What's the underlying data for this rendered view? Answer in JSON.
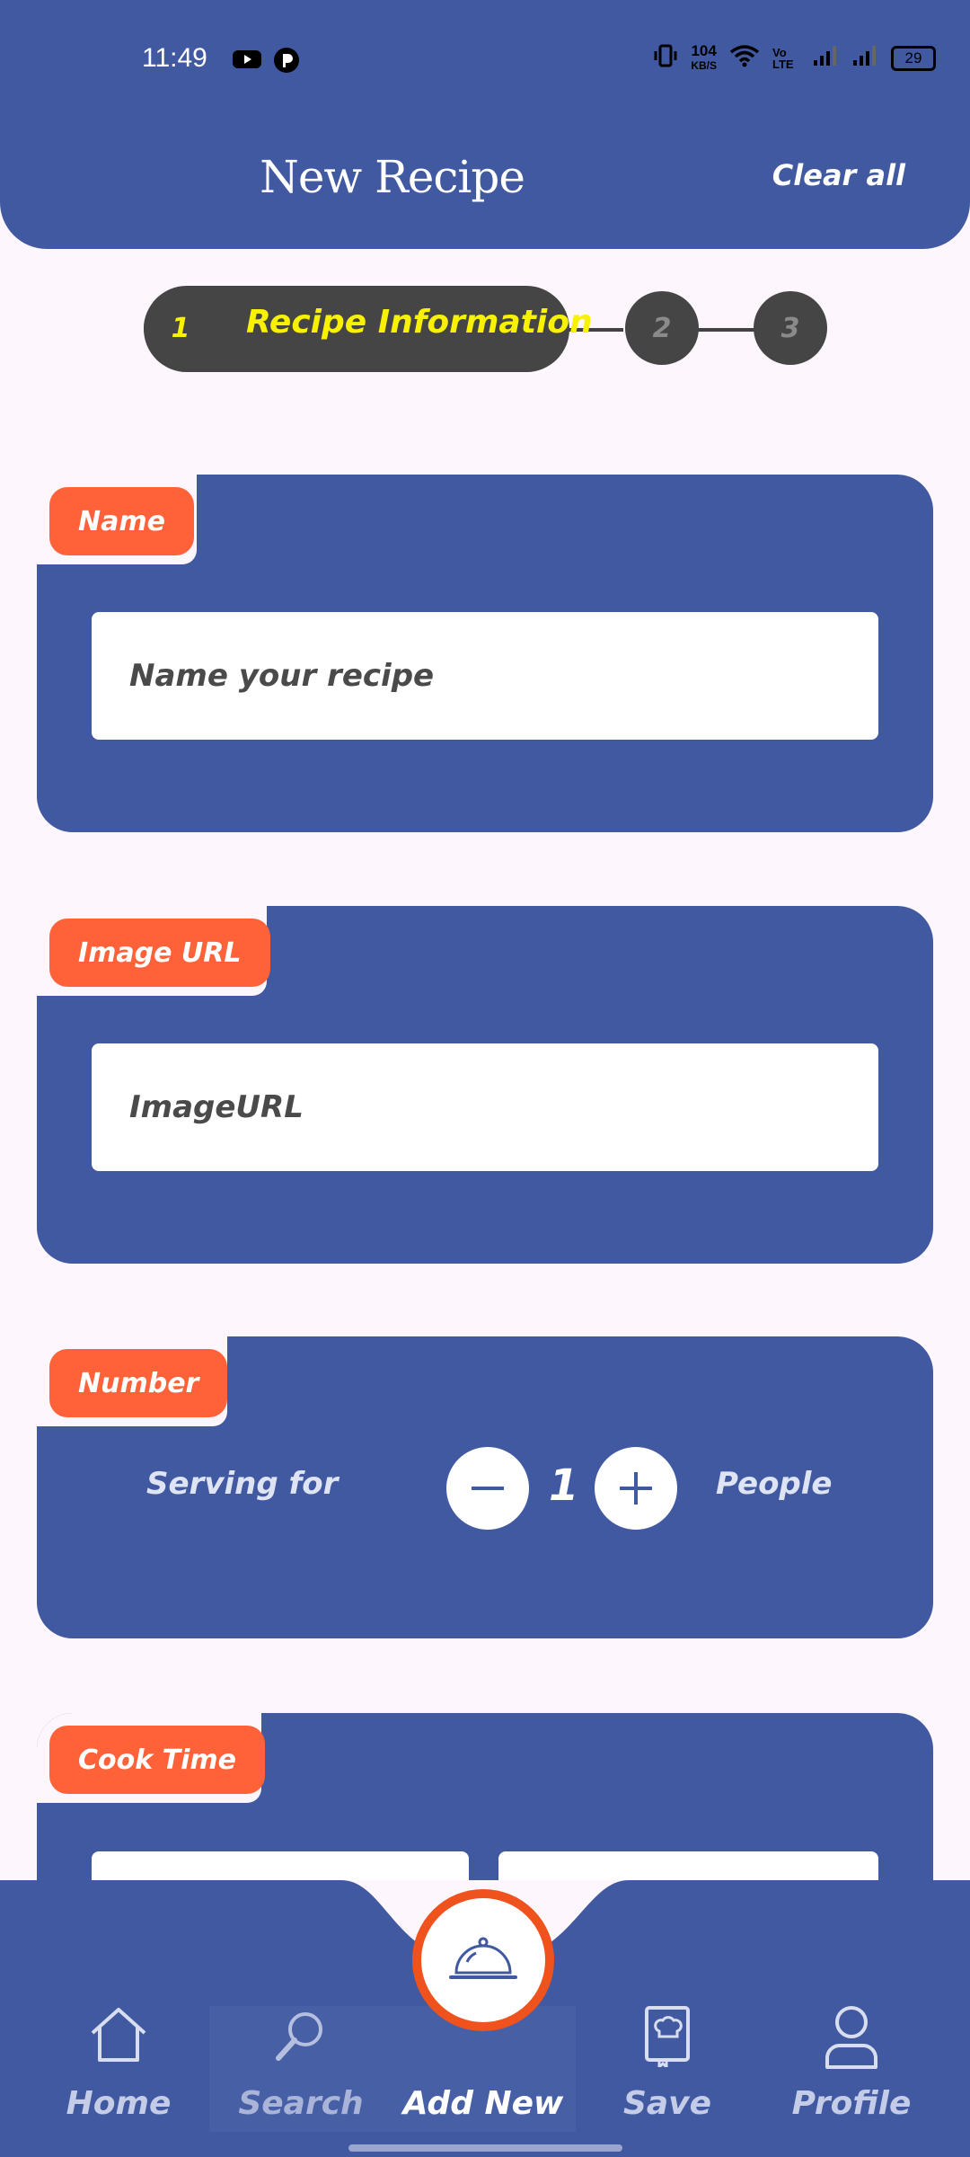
{
  "status_bar": {
    "time": "11:49",
    "net_speed_value": "104",
    "net_speed_unit": "KB/S",
    "volte": "Vo LTE",
    "battery": "29"
  },
  "header": {
    "title": "New Recipe",
    "clear_all": "Clear all"
  },
  "stepper": {
    "steps": [
      {
        "number": "1",
        "label": "Recipe Information",
        "active": true
      },
      {
        "number": "2"
      },
      {
        "number": "3"
      }
    ]
  },
  "form": {
    "name": {
      "tag": "Name",
      "placeholder": "Name your recipe"
    },
    "image_url": {
      "tag": "Image URL",
      "placeholder": "ImageURL"
    },
    "number": {
      "tag": "Number",
      "serving_label": "Serving for",
      "count": "1",
      "people_label": "People"
    },
    "cook_time": {
      "tag": "Cook Time"
    }
  },
  "nav": {
    "items": [
      {
        "label": "Home",
        "icon": "home-icon"
      },
      {
        "label": "Search",
        "icon": "search-icon"
      },
      {
        "label": "Add New",
        "icon": "cloche-icon",
        "active": true
      },
      {
        "label": "Save",
        "icon": "recipe-book-icon"
      },
      {
        "label": "Profile",
        "icon": "user-icon"
      }
    ]
  },
  "colors": {
    "primary": "#4059a1",
    "accent": "#ff6238",
    "background": "#fdf6fc",
    "step_active_text": "#f8f200"
  }
}
